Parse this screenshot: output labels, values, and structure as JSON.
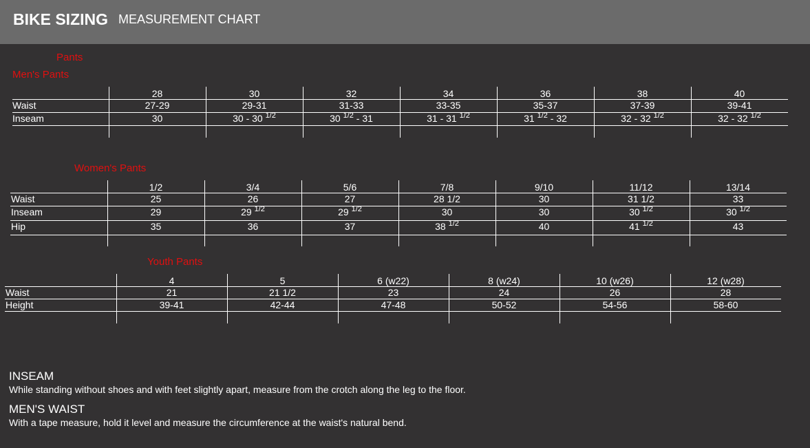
{
  "header": {
    "title": "BIKE SIZING",
    "subtitle": "MEASUREMENT CHART"
  },
  "section_title": "Pants",
  "tables": [
    {
      "title": "Men's Pants",
      "sizes": [
        "28",
        "30",
        "32",
        "34",
        "36",
        "38",
        "40"
      ],
      "rows": [
        {
          "label": "Waist",
          "values": [
            [
              "27-29"
            ],
            [
              "29-31"
            ],
            [
              "31-33"
            ],
            [
              "33-35"
            ],
            [
              "35-37"
            ],
            [
              "37-39"
            ],
            [
              "39-41"
            ]
          ]
        },
        {
          "label": "Inseam",
          "values": [
            [
              "30"
            ],
            [
              "30 - 30",
              "1/2",
              ""
            ],
            [
              "30",
              "1/2",
              " - 31"
            ],
            [
              "31 - 31",
              "1/2",
              ""
            ],
            [
              "31",
              "1/2",
              " - 32"
            ],
            [
              "32 - 32",
              "1/2",
              ""
            ],
            [
              "32 - 32",
              "1/2",
              ""
            ]
          ]
        }
      ]
    },
    {
      "title": "Women's Pants",
      "sizes": [
        "1/2",
        "3/4",
        "5/6",
        "7/8",
        "9/10",
        "11/12",
        "13/14"
      ],
      "rows": [
        {
          "label": "Waist",
          "values": [
            [
              "25"
            ],
            [
              "26"
            ],
            [
              "27"
            ],
            [
              "28 1/2"
            ],
            [
              "30"
            ],
            [
              "31 1/2"
            ],
            [
              "33"
            ]
          ]
        },
        {
          "label": "Inseam",
          "values": [
            [
              "29"
            ],
            [
              "29",
              "1/2",
              ""
            ],
            [
              "29",
              "1/2",
              ""
            ],
            [
              "30"
            ],
            [
              "30"
            ],
            [
              "30",
              "1/2",
              ""
            ],
            [
              "30",
              "1/2",
              ""
            ]
          ]
        },
        {
          "label": "Hip",
          "values": [
            [
              "35"
            ],
            [
              "36"
            ],
            [
              "37"
            ],
            [
              "38",
              "1/2",
              ""
            ],
            [
              "40"
            ],
            [
              "41",
              "1/2",
              ""
            ],
            [
              "43"
            ]
          ]
        }
      ]
    },
    {
      "title": "Youth Pants",
      "sizes": [
        "4",
        "5",
        "6 (w22)",
        "8 (w24)",
        "10 (w26)",
        "12 (w28)"
      ],
      "rows": [
        {
          "label": "Waist",
          "values": [
            [
              "21"
            ],
            [
              "21 1/2"
            ],
            [
              "23"
            ],
            [
              "24"
            ],
            [
              "26"
            ],
            [
              "28"
            ]
          ]
        },
        {
          "label": "Height",
          "values": [
            [
              "39-41"
            ],
            [
              "42-44"
            ],
            [
              "47-48"
            ],
            [
              "50-52"
            ],
            [
              "54-56"
            ],
            [
              "58-60"
            ]
          ]
        }
      ]
    }
  ],
  "notes": [
    {
      "heading": "INSEAM",
      "text": "While standing without shoes and with feet slightly apart, measure from the crotch along the leg to the floor."
    },
    {
      "heading": "MEN'S WAIST",
      "text": "With a tape measure, hold it level and measure the circumference at the waist's natural bend."
    }
  ]
}
